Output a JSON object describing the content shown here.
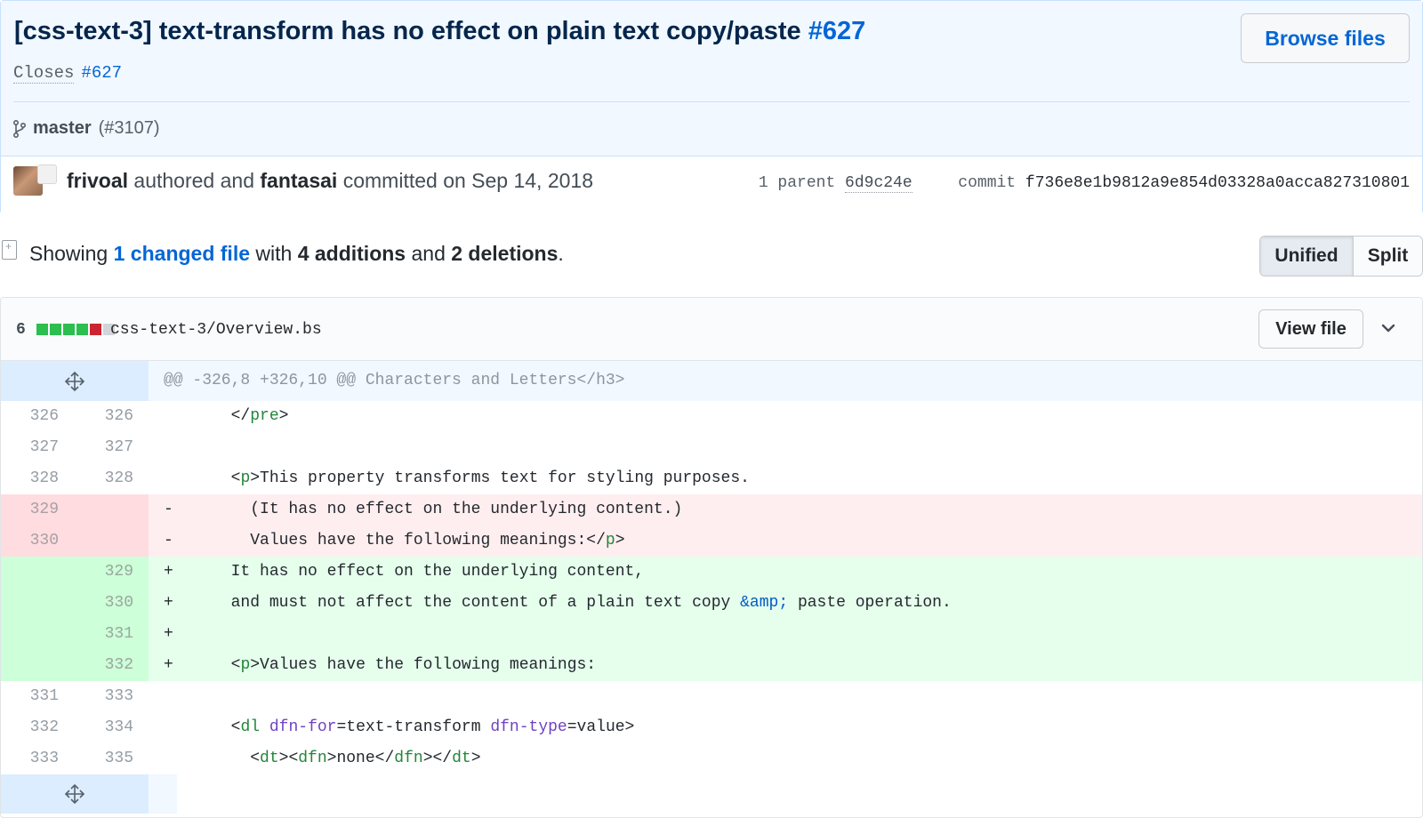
{
  "commit": {
    "title": "[css-text-3] text-transform has no effect on plain text copy/paste",
    "issue_ref": "#627",
    "browse_label": "Browse files",
    "closes_word": "Closes",
    "closes_ref": "#627",
    "branch": "master",
    "pr_ref": "(#3107)",
    "author": "frivoal",
    "authored_word": "authored and",
    "committer": "fantasai",
    "committed_text": "committed on Sep 14, 2018",
    "parent_label": "1 parent",
    "parent_sha": "6d9c24e",
    "commit_label": "commit",
    "commit_sha": "f736e8e1b9812a9e854d03328a0acca827310801"
  },
  "summary": {
    "showing": "Showing",
    "changed_files": "1 changed file",
    "with": "with",
    "additions": "4 additions",
    "and": "and",
    "deletions": "2 deletions",
    "period": ".",
    "view_modes": [
      "Unified",
      "Split"
    ],
    "active_mode": "Unified"
  },
  "file": {
    "change_count": "6",
    "diffstat": [
      "added",
      "added",
      "added",
      "added",
      "deleted",
      "neutral"
    ],
    "path": "css-text-3/Overview.bs",
    "view_file_label": "View file",
    "hunk_header": "@@ -326,8 +326,10 @@ Characters and Letters</h3>",
    "lines": [
      {
        "type": "ctx",
        "old": "326",
        "new": "326",
        "marker": " ",
        "tokens": [
          [
            "",
            "      </"
          ],
          [
            "tag",
            "pre"
          ],
          [
            "",
            ">"
          ]
        ]
      },
      {
        "type": "ctx",
        "old": "327",
        "new": "327",
        "marker": " ",
        "tokens": [
          [
            "",
            ""
          ]
        ]
      },
      {
        "type": "ctx",
        "old": "328",
        "new": "328",
        "marker": " ",
        "tokens": [
          [
            "",
            "      <"
          ],
          [
            "tag",
            "p"
          ],
          [
            "",
            ">This property transforms text for styling purposes."
          ]
        ]
      },
      {
        "type": "del",
        "old": "329",
        "new": "",
        "marker": "-",
        "tokens": [
          [
            "",
            "        (It has no effect on the underlying content.)"
          ]
        ]
      },
      {
        "type": "del",
        "old": "330",
        "new": "",
        "marker": "-",
        "tokens": [
          [
            "",
            "        Values have the following meanings:</"
          ],
          [
            "tag",
            "p"
          ],
          [
            "",
            ">"
          ]
        ]
      },
      {
        "type": "add",
        "old": "",
        "new": "329",
        "marker": "+",
        "tokens": [
          [
            "",
            "      It has no effect on the underlying content,"
          ]
        ]
      },
      {
        "type": "add",
        "old": "",
        "new": "330",
        "marker": "+",
        "tokens": [
          [
            "",
            "      and must not affect the content of a plain text copy "
          ],
          [
            "ent",
            "&amp;"
          ],
          [
            "",
            " paste operation."
          ]
        ]
      },
      {
        "type": "add",
        "old": "",
        "new": "331",
        "marker": "+",
        "tokens": [
          [
            "",
            ""
          ]
        ]
      },
      {
        "type": "add",
        "old": "",
        "new": "332",
        "marker": "+",
        "tokens": [
          [
            "",
            "      <"
          ],
          [
            "tag",
            "p"
          ],
          [
            "",
            ">Values have the following meanings:"
          ]
        ]
      },
      {
        "type": "ctx",
        "old": "331",
        "new": "333",
        "marker": " ",
        "tokens": [
          [
            "",
            ""
          ]
        ]
      },
      {
        "type": "ctx",
        "old": "332",
        "new": "334",
        "marker": " ",
        "tokens": [
          [
            "",
            "      <"
          ],
          [
            "tag",
            "dl"
          ],
          [
            "",
            " "
          ],
          [
            "attr",
            "dfn-for"
          ],
          [
            "",
            "=text-transform "
          ],
          [
            "attr",
            "dfn-type"
          ],
          [
            "",
            "=value>"
          ]
        ]
      },
      {
        "type": "ctx",
        "old": "333",
        "new": "335",
        "marker": " ",
        "tokens": [
          [
            "",
            "        <"
          ],
          [
            "tag",
            "dt"
          ],
          [
            "",
            "><"
          ],
          [
            "tag",
            "dfn"
          ],
          [
            "",
            ">none</"
          ],
          [
            "tag",
            "dfn"
          ],
          [
            "",
            "></"
          ],
          [
            "tag",
            "dt"
          ],
          [
            "",
            ">"
          ]
        ]
      }
    ]
  },
  "icons": {
    "branch": "git-branch-icon",
    "diff": "file-diff-icon",
    "expand": "unfold-icon",
    "collapse": "chevron-down-icon"
  }
}
